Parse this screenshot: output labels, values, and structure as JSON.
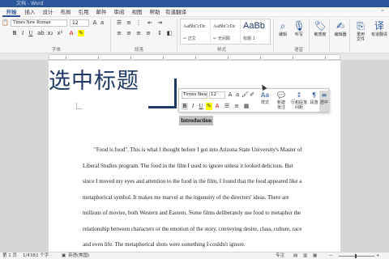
{
  "titlebar": {
    "text": "文档 - Word"
  },
  "menu": {
    "items": [
      "开始",
      "插入",
      "设计",
      "布局",
      "引用",
      "邮件",
      "审阅",
      "视图",
      "帮助",
      "有道翻译"
    ],
    "active_index": 0
  },
  "ribbon": {
    "font_name": "Times New Roman",
    "font_size": "12",
    "styles": [
      {
        "sample": "AaBbCcDc",
        "name": "↵ 正文"
      },
      {
        "sample": "AaBbCcDc",
        "name": "↵ 无间隔"
      },
      {
        "sample": "AaBb",
        "name": "标题 1"
      }
    ],
    "group_labels": {
      "font": "字体",
      "paragraph": "段落",
      "styles": "样式",
      "voice": "语音",
      "sensitivity": "敏感度",
      "editor": "编辑器",
      "reuse": "重用文件"
    },
    "buttons": {
      "edit": "编辑",
      "dictate": "听写",
      "sensitivity": "敏感度",
      "editor": "编辑器",
      "reuse": "重用\n文件",
      "translate": "有道翻译"
    }
  },
  "document": {
    "heading": "选中标题",
    "intro": "Introduction",
    "paragraph_lines": [
      "\"Food is food\". This is what I thought before I got into Arizona State University's Master of",
      "Liberal Studies program. The food in the film I used to ignore unless it looked delicious. But",
      "since I moved my eyes and attention to the food in the film, I found that the food appeared like a",
      "metaphorical symbol. It makes me marvel at the ingenuity of the directors' ideas. There are",
      "millions of movies, both Western and Eastern. Some films deliberately use food to metaphor the",
      "relationship between characters or the emotion of the story, conveying desire, class, culture, race",
      "and even life.  The metaphorical shots were something I couldn't ignore."
    ]
  },
  "minibar": {
    "font_name": "Times New",
    "font_size": "12",
    "buttons": [
      {
        "label": "样式"
      },
      {
        "label": "新建\n批注"
      },
      {
        "label": "行和段落\n间距"
      },
      {
        "label": "段落"
      },
      {
        "label": "居中"
      }
    ]
  },
  "status": {
    "page": "第 1 页",
    "words": "1/4382 个字",
    "lang": "英语(美国)",
    "focus": "专注",
    "zoom": "100%"
  }
}
